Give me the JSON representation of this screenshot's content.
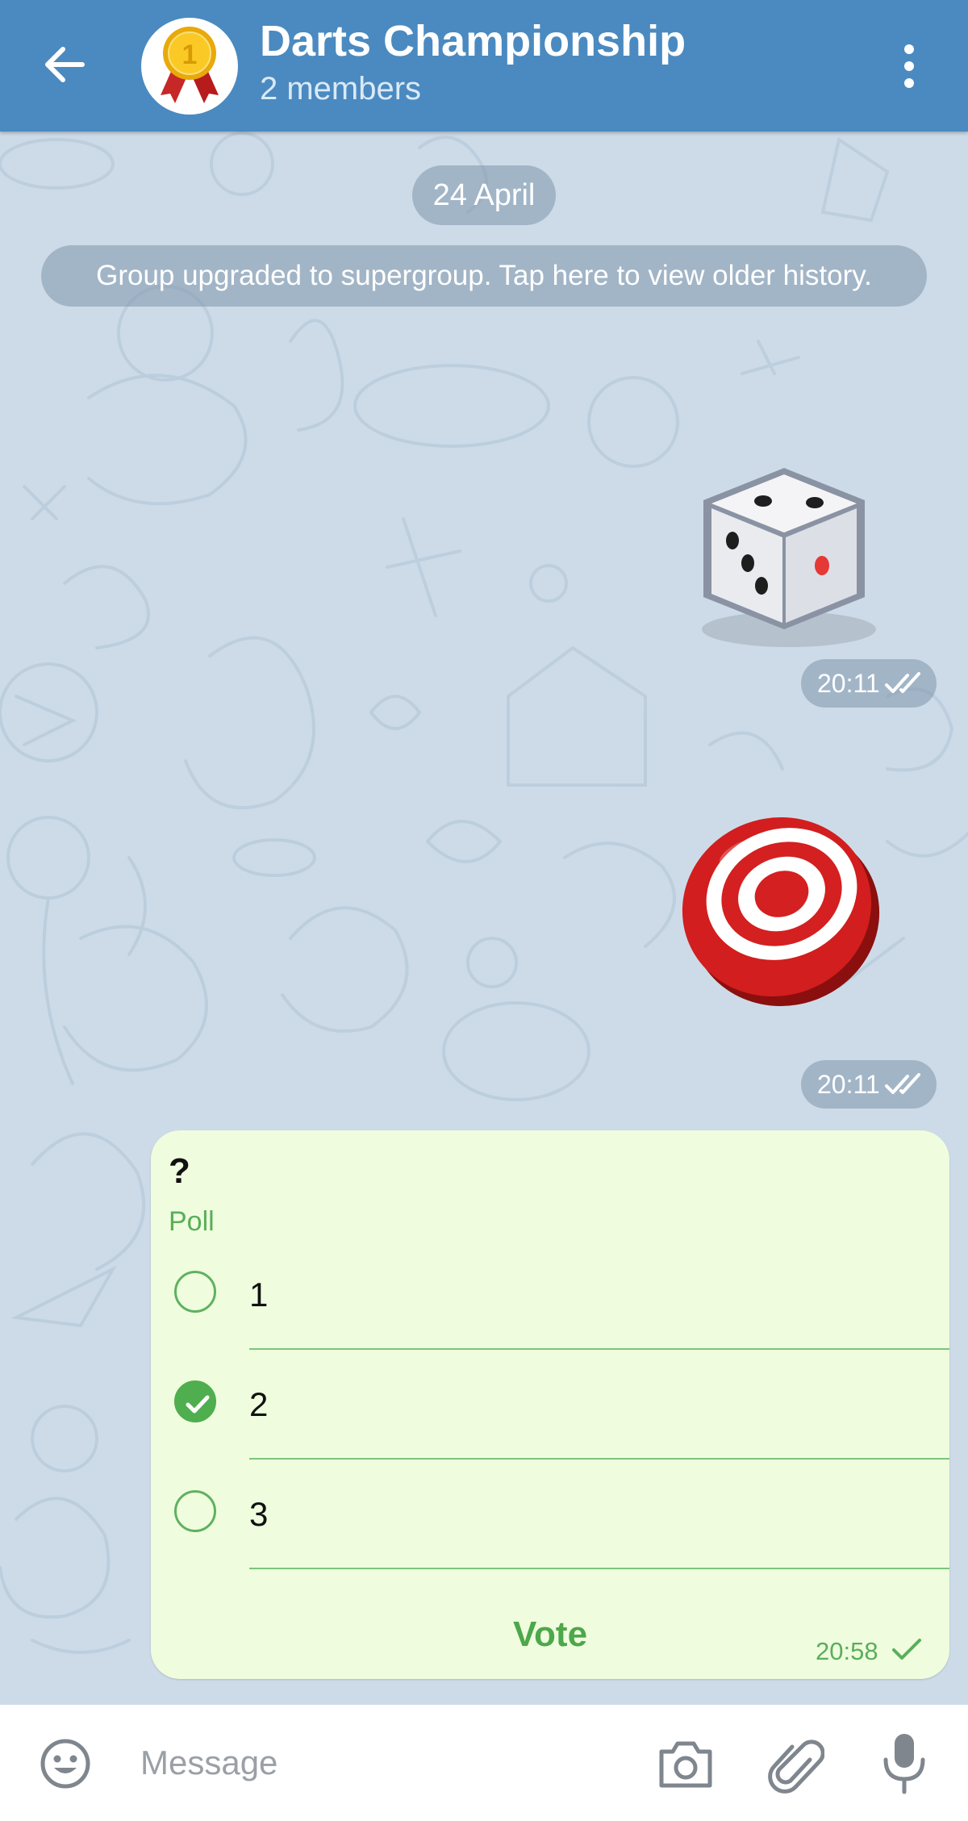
{
  "header": {
    "title": "Darts Championship",
    "subtitle": "2 members",
    "avatar_badge": "1",
    "icons": {
      "back": "arrow-left-icon",
      "menu": "more-vertical-icon",
      "avatar": "gold-medal-icon"
    }
  },
  "chat": {
    "date_label": "24 April",
    "service_message": "Group upgraded to supergroup. Tap here to view older history.",
    "messages": [
      {
        "type": "dice",
        "time": "20:11",
        "status": "read"
      },
      {
        "type": "dart",
        "time": "20:11",
        "status": "read"
      }
    ],
    "poll": {
      "question": "?",
      "type_label": "Poll",
      "options": [
        {
          "label": "1",
          "selected": false
        },
        {
          "label": "2",
          "selected": true
        },
        {
          "label": "3",
          "selected": false
        }
      ],
      "vote_label": "Vote",
      "time": "20:58",
      "status": "sent"
    }
  },
  "input": {
    "placeholder": "Message",
    "value": "",
    "icons": [
      "emoji-icon",
      "camera-icon",
      "paperclip-icon",
      "microphone-icon"
    ]
  },
  "colors": {
    "header": "#4a8ac0",
    "chat_background": "#cddbe8",
    "poll_bubble": "#effdde",
    "accent_green": "#4fae4e"
  }
}
